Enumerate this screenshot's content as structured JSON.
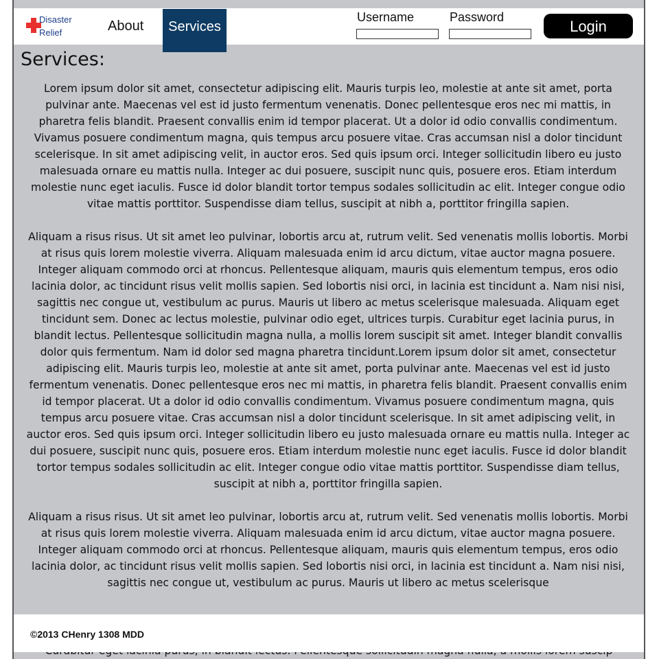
{
  "logo": {
    "line1": "Disaster",
    "line2": "Relief"
  },
  "nav": {
    "about": "About",
    "services": "Services"
  },
  "login": {
    "username_label": "Username",
    "password_label": "Password",
    "username_value": "",
    "password_value": "",
    "button_label": "Login"
  },
  "page": {
    "title": "Services:",
    "paragraphs": [
      "Lorem ipsum dolor sit amet, consectetur adipiscing elit. Mauris turpis leo, molestie at ante sit amet, porta pulvinar ante. Maecenas vel est id justo fermentum venenatis. Donec pellentesque eros nec mi mattis, in pharetra felis blandit. Praesent convallis enim id tempor placerat. Ut a dolor id odio convallis condimentum. Vivamus posuere condimentum magna, quis tempus arcu posuere vitae. Cras accumsan nisl a dolor tincidunt scelerisque. In sit amet adipiscing velit, in auctor eros. Sed quis ipsum orci. Integer sollicitudin libero eu justo malesuada ornare eu mattis nulla. Integer ac dui posuere, suscipit nunc quis, posuere eros. Etiam interdum molestie nunc eget iaculis. Fusce id dolor blandit tortor tempus sodales sollicitudin ac elit. Integer congue odio vitae mattis porttitor. Suspendisse diam tellus, suscipit at nibh a, porttitor fringilla sapien.",
      "Aliquam a risus risus. Ut sit amet leo pulvinar, lobortis arcu at, rutrum velit. Sed venenatis mollis lobortis. Morbi at risus quis lorem molestie viverra. Aliquam malesuada enim id arcu dictum, vitae auctor magna posuere. Integer aliquam commodo orci at rhoncus. Pellentesque aliquam, mauris quis elementum tempus, eros odio lacinia dolor, ac tincidunt risus velit mollis sapien. Sed lobortis nisi orci, in lacinia est tincidunt a. Nam nisi nisi, sagittis nec congue ut, vestibulum ac purus. Mauris ut libero ac metus scelerisque malesuada. Aliquam eget tincidunt sem. Donec ac lectus molestie, pulvinar odio eget, ultrices turpis. Curabitur eget lacinia purus, in blandit lectus. Pellentesque sollicitudin magna nulla, a mollis lorem suscipit sit amet. Integer blandit convallis dolor quis fermentum. Nam id dolor sed magna pharetra tincidunt.Lorem ipsum dolor sit amet, consectetur adipiscing elit. Mauris turpis leo, molestie at ante sit amet, porta pulvinar ante. Maecenas vel est id justo fermentum venenatis. Donec pellentesque eros nec mi mattis, in pharetra felis blandit. Praesent convallis enim id tempor placerat. Ut a dolor id odio convallis condimentum. Vivamus posuere condimentum magna, quis tempus arcu posuere vitae. Cras accumsan nisl a dolor tincidunt scelerisque. In sit amet adipiscing velit, in auctor eros. Sed quis ipsum orci. Integer sollicitudin libero eu justo malesuada ornare eu mattis nulla. Integer ac dui posuere, suscipit nunc quis, posuere eros. Etiam interdum molestie nunc eget iaculis. Fusce id dolor blandit tortor tempus sodales sollicitudin ac elit. Integer congue odio vitae mattis porttitor. Suspendisse diam tellus, suscipit at nibh a, porttitor fringilla sapien.",
      "Aliquam a risus risus. Ut sit amet leo pulvinar, lobortis arcu at, rutrum velit. Sed venenatis mollis lobortis. Morbi at risus quis lorem molestie viverra. Aliquam malesuada enim id arcu dictum, vitae auctor magna posuere. Integer aliquam commodo orci at rhoncus. Pellentesque aliquam, mauris quis elementum tempus, eros odio lacinia dolor, ac tincidunt risus velit mollis sapien. Sed lobortis nisi orci, in lacinia est tincidunt a. Nam nisi nisi, sagittis nec congue ut, vestibulum ac purus. Mauris ut libero ac metus scelerisque"
    ],
    "bottom_fragment": "Curabitur eget lacinia purus, in blandit lectus. Pellentesque sollicitudin magna nulla, a mollis lorem suscip"
  },
  "footer": {
    "copyright": "©2013 CHenry 1308 MDD"
  },
  "colors": {
    "content_bg": "#c5c6ca",
    "nav_active": "#0e3b63",
    "logo_red": "#e8312f",
    "logo_blue": "#1e3f8a",
    "login_bg": "#000000"
  }
}
